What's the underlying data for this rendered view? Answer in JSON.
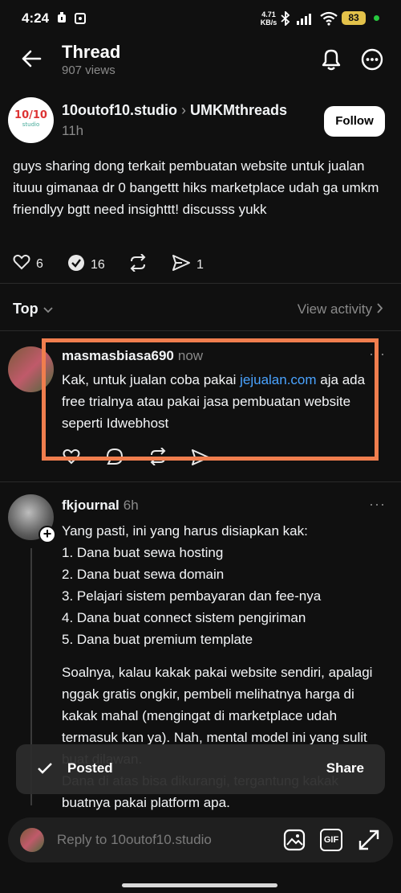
{
  "status_bar": {
    "time": "4:24",
    "net_speed_value": "4.71",
    "net_speed_unit": "KB/s",
    "battery": "83"
  },
  "header": {
    "title": "Thread",
    "views": "907 views"
  },
  "post": {
    "author": "10outof10.studio",
    "community": "UMKMthreads",
    "time": "11h",
    "follow_label": "Follow",
    "text": "guys sharing dong terkait pembuatan website untuk jualan ituuu gimanaa dr 0 bangettt hiks marketplace udah ga umkm friendlyy bgtt need insighttt! discusss yukk",
    "likes": "6",
    "replies": "16",
    "shares": "1",
    "avatar_logo_top": "10/10",
    "avatar_logo_bottom": "studio"
  },
  "sort": {
    "label": "Top",
    "view_activity": "View activity"
  },
  "replies": [
    {
      "author": "masmasbiasa690",
      "time": "now",
      "text_before": "Kak, untuk jualan coba pakai ",
      "link": "jejualan.com",
      "text_after": " aja ada free trialnya atau pakai jasa pembuatan website seperti Idwebhost"
    },
    {
      "author": "fkjournal",
      "time": "6h",
      "intro": "Yang pasti, ini yang harus disiapkan kak:",
      "list": [
        "1. Dana buat sewa hosting",
        "2. Dana buat sewa domain",
        "3. Pelajari sistem pembayaran dan fee-nya",
        "4. Dana buat connect sistem pengiriman",
        "5. Dana buat premium template"
      ],
      "para": "Soalnya, kalau kakak pakai website sendiri, apalagi nggak gratis ongkir, pembeli melihatnya harga di kakak mahal (mengingat di marketplace udah termasuk kan ya). Nah, mental model ini yang sulit buat dilawan.",
      "para2": "Dana di atas bisa dikurangi, tergantung kakak buatnya pakai platform apa."
    }
  ],
  "toast": {
    "label": "Posted",
    "action": "Share"
  },
  "reply_bar": {
    "placeholder": "Reply to 10outof10.studio",
    "gif_label": "GIF"
  },
  "colors": {
    "background": "#101010",
    "highlight": "#f07e4e",
    "link": "#4aa3ff",
    "battery": "#e3c24a"
  }
}
